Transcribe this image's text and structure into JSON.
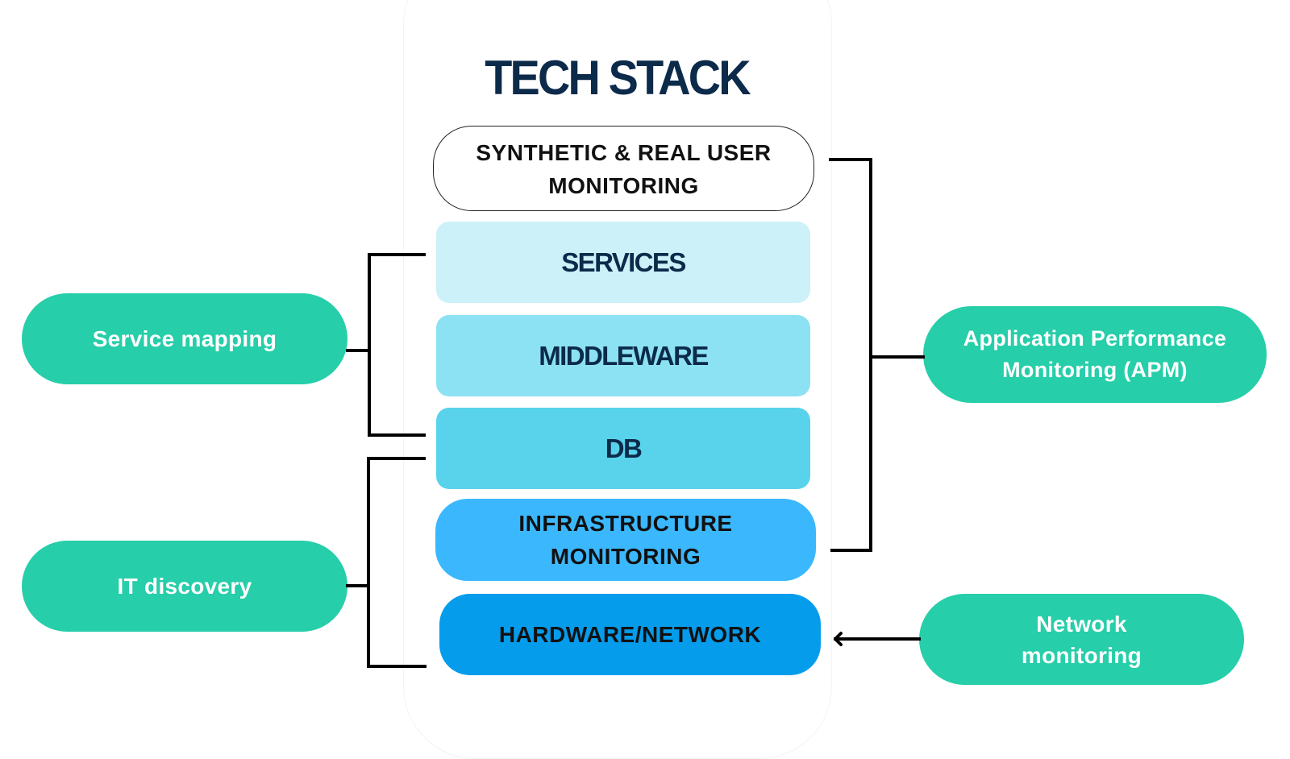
{
  "title": "TECH STACK",
  "stack_layers": [
    {
      "id": "rum",
      "lines": [
        "SYNTHETIC & REAL USER",
        "MONITORING"
      ],
      "color": "#ffffff"
    },
    {
      "id": "services",
      "lines": [
        "SERVICES"
      ],
      "color": "#ccf1f8"
    },
    {
      "id": "middleware",
      "lines": [
        "MIDDLEWARE"
      ],
      "color": "#8ce1f2"
    },
    {
      "id": "db",
      "lines": [
        "DB"
      ],
      "color": "#59d3ec"
    },
    {
      "id": "infra",
      "lines": [
        "INFRASTRUCTURE",
        "MONITORING"
      ],
      "color": "#3bb8fd"
    },
    {
      "id": "hardware",
      "lines": [
        "HARDWARE/NETWORK"
      ],
      "color": "#059cec"
    }
  ],
  "capabilities": {
    "service_mapping": {
      "lines": [
        "Service mapping"
      ],
      "covers": [
        "SERVICES",
        "MIDDLEWARE",
        "DB"
      ]
    },
    "it_discovery": {
      "lines": [
        "IT discovery"
      ],
      "covers": [
        "DB",
        "INFRASTRUCTURE MONITORING",
        "HARDWARE/NETWORK"
      ]
    },
    "apm": {
      "lines": [
        "Application Performance",
        "Monitoring (APM)"
      ],
      "covers": [
        "SYNTHETIC & REAL USER MONITORING",
        "SERVICES",
        "MIDDLEWARE",
        "DB",
        "INFRASTRUCTURE MONITORING"
      ]
    },
    "network_monitoring": {
      "lines": [
        "Network",
        "monitoring"
      ],
      "points_to": "HARDWARE/NETWORK"
    }
  },
  "colors": {
    "capability_pill": "#26cea9",
    "title_text": "#0c2a4a",
    "connector": "#000000"
  }
}
